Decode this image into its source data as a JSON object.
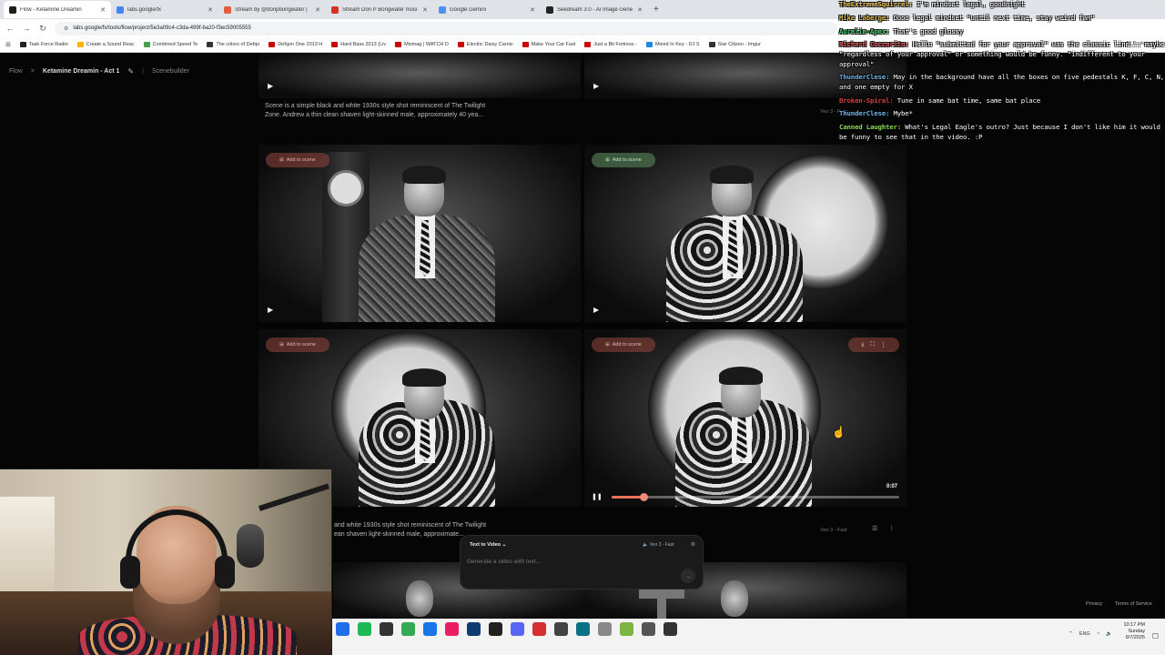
{
  "browser": {
    "tabs": [
      {
        "label": "Flow - Ketamine Dreamin",
        "active": true,
        "color": "#1e1e1e"
      },
      {
        "label": "labs.google/fx",
        "active": false,
        "color": "#4285f4"
      },
      {
        "label": "Stream by @donpbongwater |",
        "active": false,
        "color": "#e55d3a"
      },
      {
        "label": "Stream Don P Bongwater musi",
        "active": false,
        "color": "#d93025"
      },
      {
        "label": "Google Gemini",
        "active": false,
        "color": "#4c8df6"
      },
      {
        "label": "Seedream 3.0 - AI Image Gene",
        "active": false,
        "color": "#222222"
      }
    ],
    "new_tab": "+",
    "url": "labs.google/fx/tools/flow/project/5e3a09c4-c3da-499f-ba20-f3ec59005555",
    "bookmarks": [
      {
        "label": "Task Force Radio",
        "color": "#222"
      },
      {
        "label": "Create a Sound Reac",
        "color": "#ffb300"
      },
      {
        "label": "Combined Speed Te",
        "color": "#43a047"
      },
      {
        "label": "The colors of Defqo",
        "color": "#333"
      },
      {
        "label": "Defqon One 2013 H",
        "color": "#c00"
      },
      {
        "label": "Hard Bass 2013 (Liv",
        "color": "#c00"
      },
      {
        "label": "Mixmag | WATCH D",
        "color": "#c00"
      },
      {
        "label": "Electric Daisy Carniv",
        "color": "#c00"
      },
      {
        "label": "Make Your Car Fast",
        "color": "#c00"
      },
      {
        "label": "Just a Bit Fortress -",
        "color": "#c00"
      },
      {
        "label": "Mixed In Key - DJ S",
        "color": "#1e88e5"
      },
      {
        "label": "Star Citizen - Imgur",
        "color": "#333"
      }
    ],
    "all_bookmarks": "All Bookmarks"
  },
  "flow": {
    "breadcrumb": {
      "root": "Flow",
      "separator": ">",
      "project": "Ketamine Dreamin - Act 1",
      "view": "Scenebuilder"
    },
    "scene1": {
      "description_line1": "Scene is a simple black and white 1930s style shot reminiscent of The Twilight",
      "description_line2": "Zone. Andrew a thin clean shaven light-skinned male, approximately 40 yea...",
      "model": "Veo 3 - Fast"
    },
    "add_to_scene": "Add to scene",
    "play_symbol": "▶",
    "pause_symbol": "❚❚",
    "video": {
      "time": "0:07",
      "progress": 0.11
    },
    "scene2": {
      "description_line1": "and white 1930s style shot reminiscent of The Twilight",
      "description_line2": "ean shaven light-skinned male, approximate...",
      "model": "Veo 3 - Fast"
    },
    "prompt": {
      "mode": "Text to Video",
      "model": "Veo 3 - Fast",
      "placeholder": "Generate a video with text..."
    },
    "footer": {
      "privacy": "Privacy",
      "terms": "Terms of Service"
    }
  },
  "chat": [
    {
      "user": "TheExtremeSquirrel:",
      "text": "I'm mindset legal, goodnight",
      "color": "#e8c060"
    },
    {
      "user": "Mike Laberge:",
      "text": "Oooo legal mindset \"until next time, stay weird fam\"",
      "color": "#d7b84a"
    },
    {
      "user": "Aurelie-Apex:",
      "text": "That's good glossy",
      "color": "#4ac76a"
    },
    {
      "user": "Richard Coccarito:",
      "text": "Hello \"submitted for your approval\" was the classic line... maybe \"regardless of your approval\" or something would be funny. \"indifferent to your approval\"",
      "color": "#e05555"
    },
    {
      "user": "ThunderClese:",
      "text": "May in the background have all the boxes on five pedestals K, F, C, N, and one empty for X",
      "color": "#6fb6e8"
    },
    {
      "user": "Broken-Spiral:",
      "text": "Tune in same bat time, same bat place",
      "color": "#d94040"
    },
    {
      "user": "ThunderClese:",
      "text": "Mybe*",
      "color": "#6fb6e8"
    },
    {
      "user": "Canned Laughter:",
      "text": "What's Legal Eagle's outro? Just because I don't like him it would be funny to see that in the video. :P",
      "color": "#8ad65a"
    }
  ],
  "taskbar": {
    "icons": [
      {
        "name": "edge-icon",
        "color": "#1f6feb"
      },
      {
        "name": "spotify-icon",
        "color": "#1db954"
      },
      {
        "name": "files-icon",
        "color": "#333333"
      },
      {
        "name": "chrome-icon",
        "color": "#34a853"
      },
      {
        "name": "browser-icon",
        "color": "#1a73e8"
      },
      {
        "name": "store-icon",
        "color": "#e91e63"
      },
      {
        "name": "terminal-icon",
        "color": "#0f3b6e"
      },
      {
        "name": "app-icon",
        "color": "#222222"
      },
      {
        "name": "discord-icon",
        "color": "#5865f2"
      },
      {
        "name": "record-icon",
        "color": "#d32f2f"
      },
      {
        "name": "app2-icon",
        "color": "#444444"
      },
      {
        "name": "app3-icon",
        "color": "#0b7285"
      },
      {
        "name": "pen-icon",
        "color": "#888888"
      },
      {
        "name": "app4-icon",
        "color": "#7cb342"
      },
      {
        "name": "settings-icon",
        "color": "#555555"
      },
      {
        "name": "obs-icon",
        "color": "#333333"
      }
    ],
    "language": "ENG",
    "time": "10:17 PM",
    "day": "Sunday",
    "date": "9/7/2025"
  }
}
